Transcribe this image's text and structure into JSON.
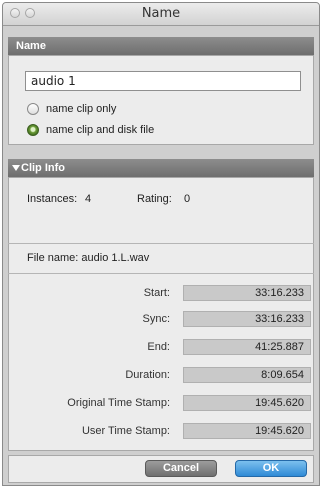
{
  "window": {
    "title": "Name"
  },
  "name_section": {
    "header": "Name",
    "input_value": "audio 1",
    "options": [
      {
        "label": "name clip only",
        "selected": false
      },
      {
        "label": "name clip and disk file",
        "selected": true
      }
    ]
  },
  "clip_info": {
    "header": "Clip Info",
    "instances_label": "Instances:",
    "instances_value": "4",
    "rating_label": "Rating:",
    "rating_value": "0",
    "file_name": "File name: audio 1.L.wav",
    "rows": [
      {
        "label": "Start:",
        "value": "33:16.233"
      },
      {
        "label": "Sync:",
        "value": "33:16.233"
      },
      {
        "label": "End:",
        "value": "41:25.887"
      },
      {
        "label": "Duration:",
        "value": "8:09.654"
      },
      {
        "label": "Original Time Stamp:",
        "value": "19:45.620"
      },
      {
        "label": "User Time Stamp:",
        "value": "19:45.620"
      }
    ]
  },
  "footer": {
    "cancel_label": "Cancel",
    "ok_label": "OK"
  },
  "colors": {
    "accent": "#2f8ad6",
    "radio_selected": "#6c9c38",
    "header_bg": "#7a7a7a"
  }
}
